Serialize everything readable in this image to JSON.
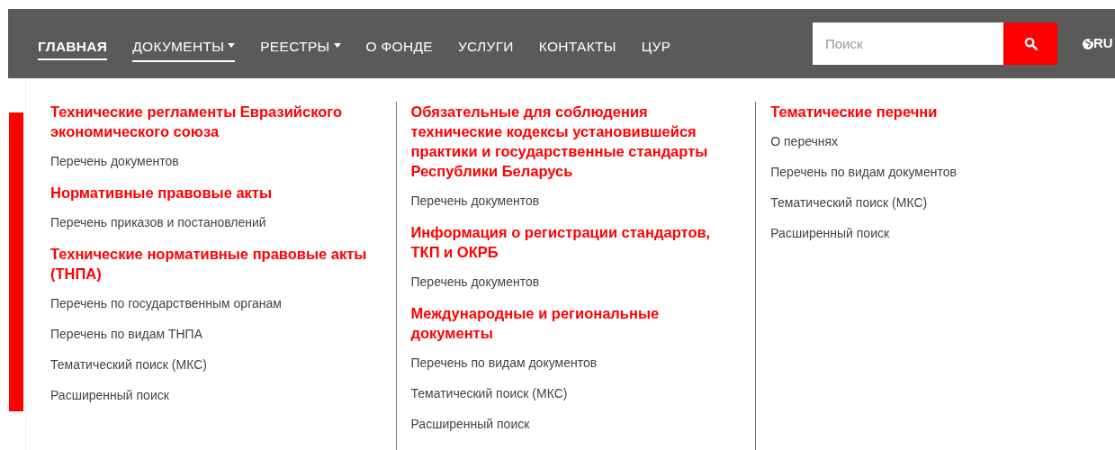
{
  "nav": {
    "items": [
      {
        "label": "ГЛАВНАЯ",
        "kind": "link",
        "selected": true,
        "expanded": false
      },
      {
        "label": "ДОКУМЕНТЫ",
        "kind": "dropdown",
        "selected": false,
        "expanded": true
      },
      {
        "label": "РЕЕСТРЫ",
        "kind": "dropdown",
        "selected": false,
        "expanded": false
      },
      {
        "label": "О ФОНДЕ",
        "kind": "link",
        "selected": false,
        "expanded": false
      },
      {
        "label": "УСЛУГИ",
        "kind": "link",
        "selected": false,
        "expanded": false
      },
      {
        "label": "КОНТАКТЫ",
        "kind": "link",
        "selected": false,
        "expanded": false
      },
      {
        "label": "ЦУР",
        "kind": "link",
        "selected": false,
        "expanded": false
      }
    ],
    "search": {
      "placeholder": "Поиск"
    },
    "language": "RU"
  },
  "dropdown": {
    "columns": [
      {
        "sections": [
          {
            "heading": "Технические регламенты Евразийского экономического союза",
            "links": [
              "Перечень документов"
            ]
          },
          {
            "heading": "Нормативные правовые акты",
            "links": [
              "Перечень приказов и постановлений"
            ]
          },
          {
            "heading": "Технические нормативные правовые акты (ТНПА)",
            "links": [
              "Перечень по государственным органам",
              "Перечень по видам ТНПА",
              "Тематический поиск (МКС)",
              "Расширенный поиск"
            ]
          }
        ]
      },
      {
        "sections": [
          {
            "heading": "Обязательные для соблюдения технические кодексы установившейся практики и государственные стандарты Республики Беларусь",
            "links": [
              "Перечень документов"
            ]
          },
          {
            "heading": "Информация о регистрации стандартов, ТКП и ОКРБ",
            "links": [
              "Перечень документов"
            ]
          },
          {
            "heading": "Международные и региональные документы",
            "links": [
              "Перечень по видам документов",
              "Тематический поиск (МКС)",
              "Расширенный поиск"
            ]
          }
        ]
      },
      {
        "sections": [
          {
            "heading": "Тематические перечни",
            "links": [
              "О перечнях",
              "Перечень по видам документов",
              "Тематический поиск (МКС)",
              "Расширенный поиск"
            ]
          }
        ]
      }
    ]
  }
}
